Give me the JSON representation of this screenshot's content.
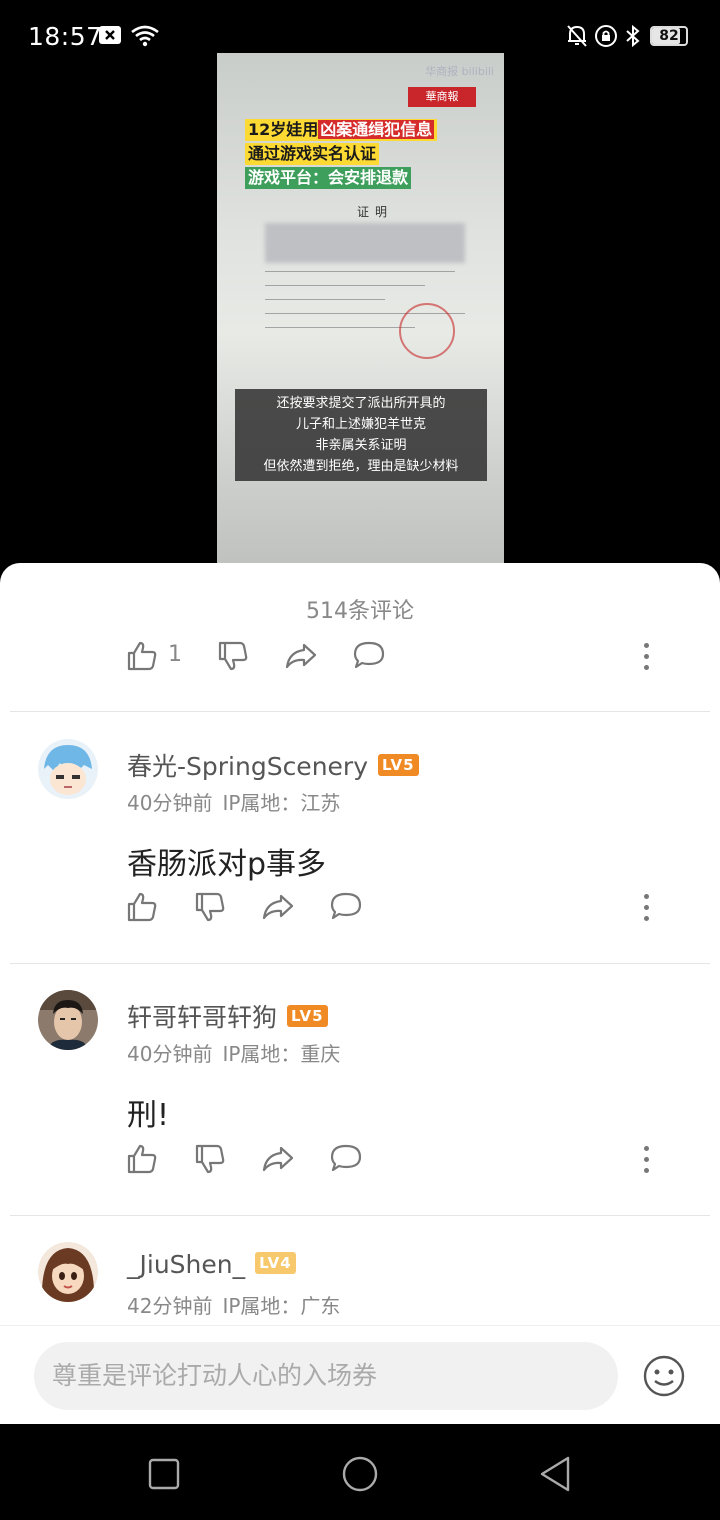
{
  "status_bar": {
    "time": "18:57",
    "battery": "82",
    "battery_level_percent": 82,
    "icons": [
      "close-box-icon",
      "wifi-icon",
      "bell-off-icon",
      "lock-rotation-icon",
      "bluetooth-icon"
    ]
  },
  "video": {
    "watermark": "华商报 bilibili",
    "logo_text": "華商報",
    "headline_1_prefix": "12岁娃用",
    "headline_1_highlight": "凶案通缉犯信息",
    "headline_2": "通过游戏实名认证",
    "headline_3": "游戏平台：会安排退款",
    "doc_title": "证明",
    "subtitle_lines": [
      "还按要求提交了派出所开具的",
      "儿子和上述嫌犯羊世克",
      "非亲属关系证明",
      "但依然遭到拒绝，理由是缺少材料"
    ]
  },
  "comments_header": {
    "count_label": "514条评论",
    "like_count": "1"
  },
  "comments": [
    {
      "username": "春光-SpringScenery",
      "level": "LV5",
      "time": "40分钟前",
      "ip": "IP属地：江苏",
      "text": "香肠派对p事多"
    },
    {
      "username": "轩哥轩哥轩狗",
      "level": "LV5",
      "time": "40分钟前",
      "ip": "IP属地：重庆",
      "text": "刑!"
    },
    {
      "username": "_JiuShen_",
      "level": "LV4",
      "time": "42分钟前",
      "ip": "IP属地：广东",
      "text": ""
    }
  ],
  "input_bar": {
    "placeholder": "尊重是评论打动人心的入场券"
  },
  "colors": {
    "accent_lv5": "#f08a24",
    "accent_lv4": "#f7c86c",
    "sheet_bg": "#ffffff",
    "icon_gray": "#777777"
  }
}
